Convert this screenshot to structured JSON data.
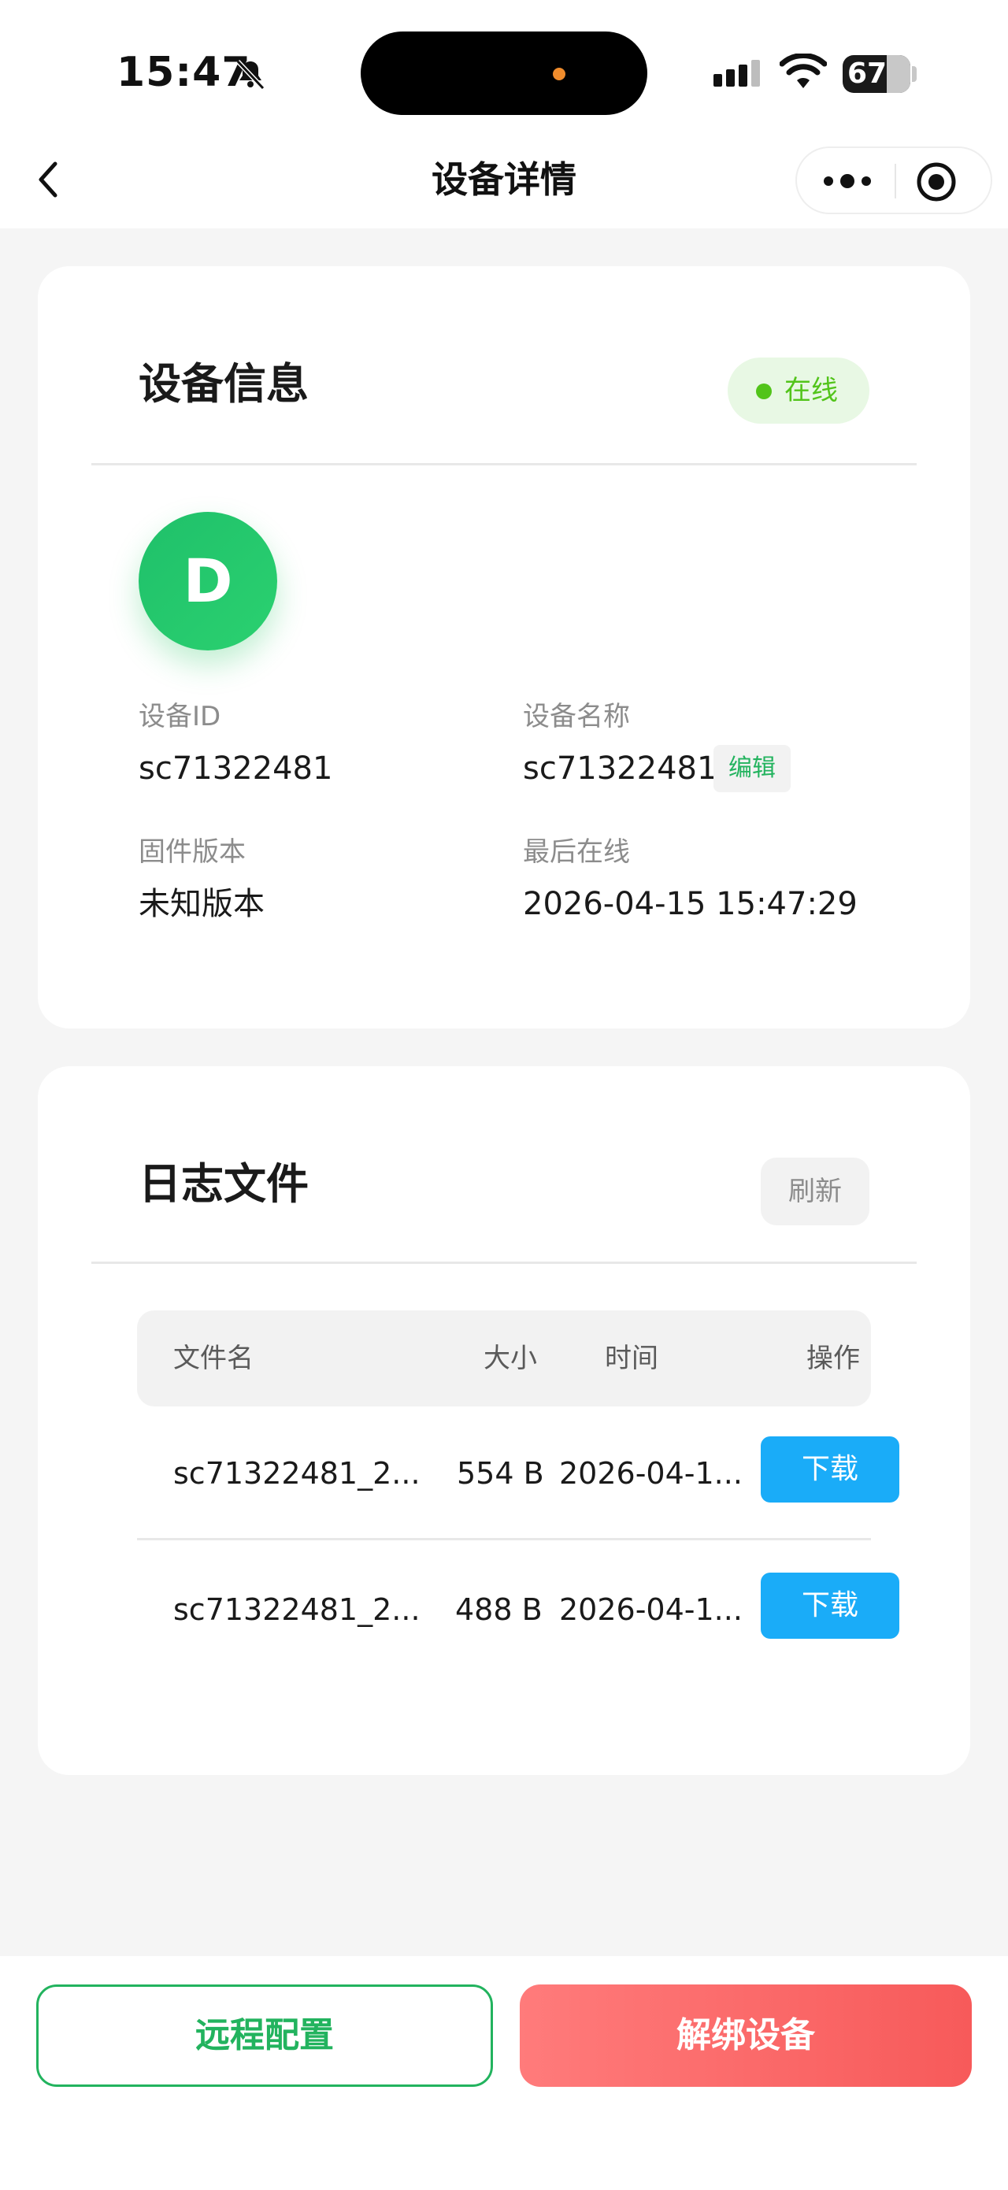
{
  "status_bar": {
    "time": "15:47",
    "battery": "67"
  },
  "nav": {
    "title": "设备详情"
  },
  "device_card": {
    "title": "设备信息",
    "status": "在线",
    "avatar_letter": "D",
    "fields": {
      "id_label": "设备ID",
      "id_value": "sc71322481",
      "name_label": "设备名称",
      "name_value": "sc71322481",
      "edit_label": "编辑",
      "firmware_label": "固件版本",
      "firmware_value": "未知版本",
      "last_online_label": "最后在线",
      "last_online_value": "2026-04-15 15:47:29"
    }
  },
  "logs_card": {
    "title": "日志文件",
    "refresh_label": "刷新",
    "columns": [
      "文件名",
      "大小",
      "时间",
      "操作"
    ],
    "rows": [
      {
        "name": "sc71322481_2...",
        "size": "554 B",
        "time": "2026-04-1...",
        "action": "下载"
      },
      {
        "name": "sc71322481_2...",
        "size": "488 B",
        "time": "2026-04-1...",
        "action": "下载"
      }
    ]
  },
  "bottom": {
    "remote_config": "远程配置",
    "unbind": "解绑设备"
  },
  "colors": {
    "accent_green": "#22b35e",
    "online_green": "#52c41a",
    "download_blue": "#1aacf8",
    "danger_red": "#f75a5a"
  },
  "icons": [
    "bell-slash-icon",
    "signal-icon",
    "wifi-icon",
    "battery-icon",
    "back-chevron-icon",
    "more-dots-icon",
    "close-target-icon"
  ]
}
